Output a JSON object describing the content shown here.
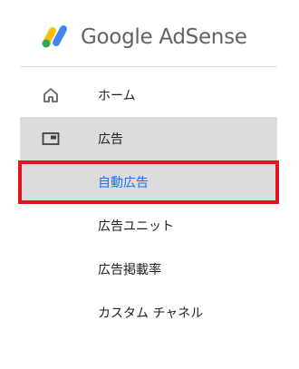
{
  "header": {
    "brand": "Google AdSense",
    "logo_icon": "adsense-logo-icon"
  },
  "nav": {
    "items": [
      {
        "label": "ホーム",
        "icon": "home-icon"
      },
      {
        "label": "広告",
        "icon": "ad-unit-icon",
        "state": "selected"
      },
      {
        "label": "自動広告",
        "state": "current"
      },
      {
        "label": "広告ユニット"
      },
      {
        "label": "広告掲載率"
      },
      {
        "label": "カスタム チャネル"
      }
    ]
  },
  "colors": {
    "selected_bg": "#dcdcdc",
    "highlight_border": "#e0161f",
    "link_blue": "#1a73e8",
    "logo_yellow": "#fbbc04",
    "logo_blue": "#4285f4",
    "logo_green": "#34a853"
  }
}
